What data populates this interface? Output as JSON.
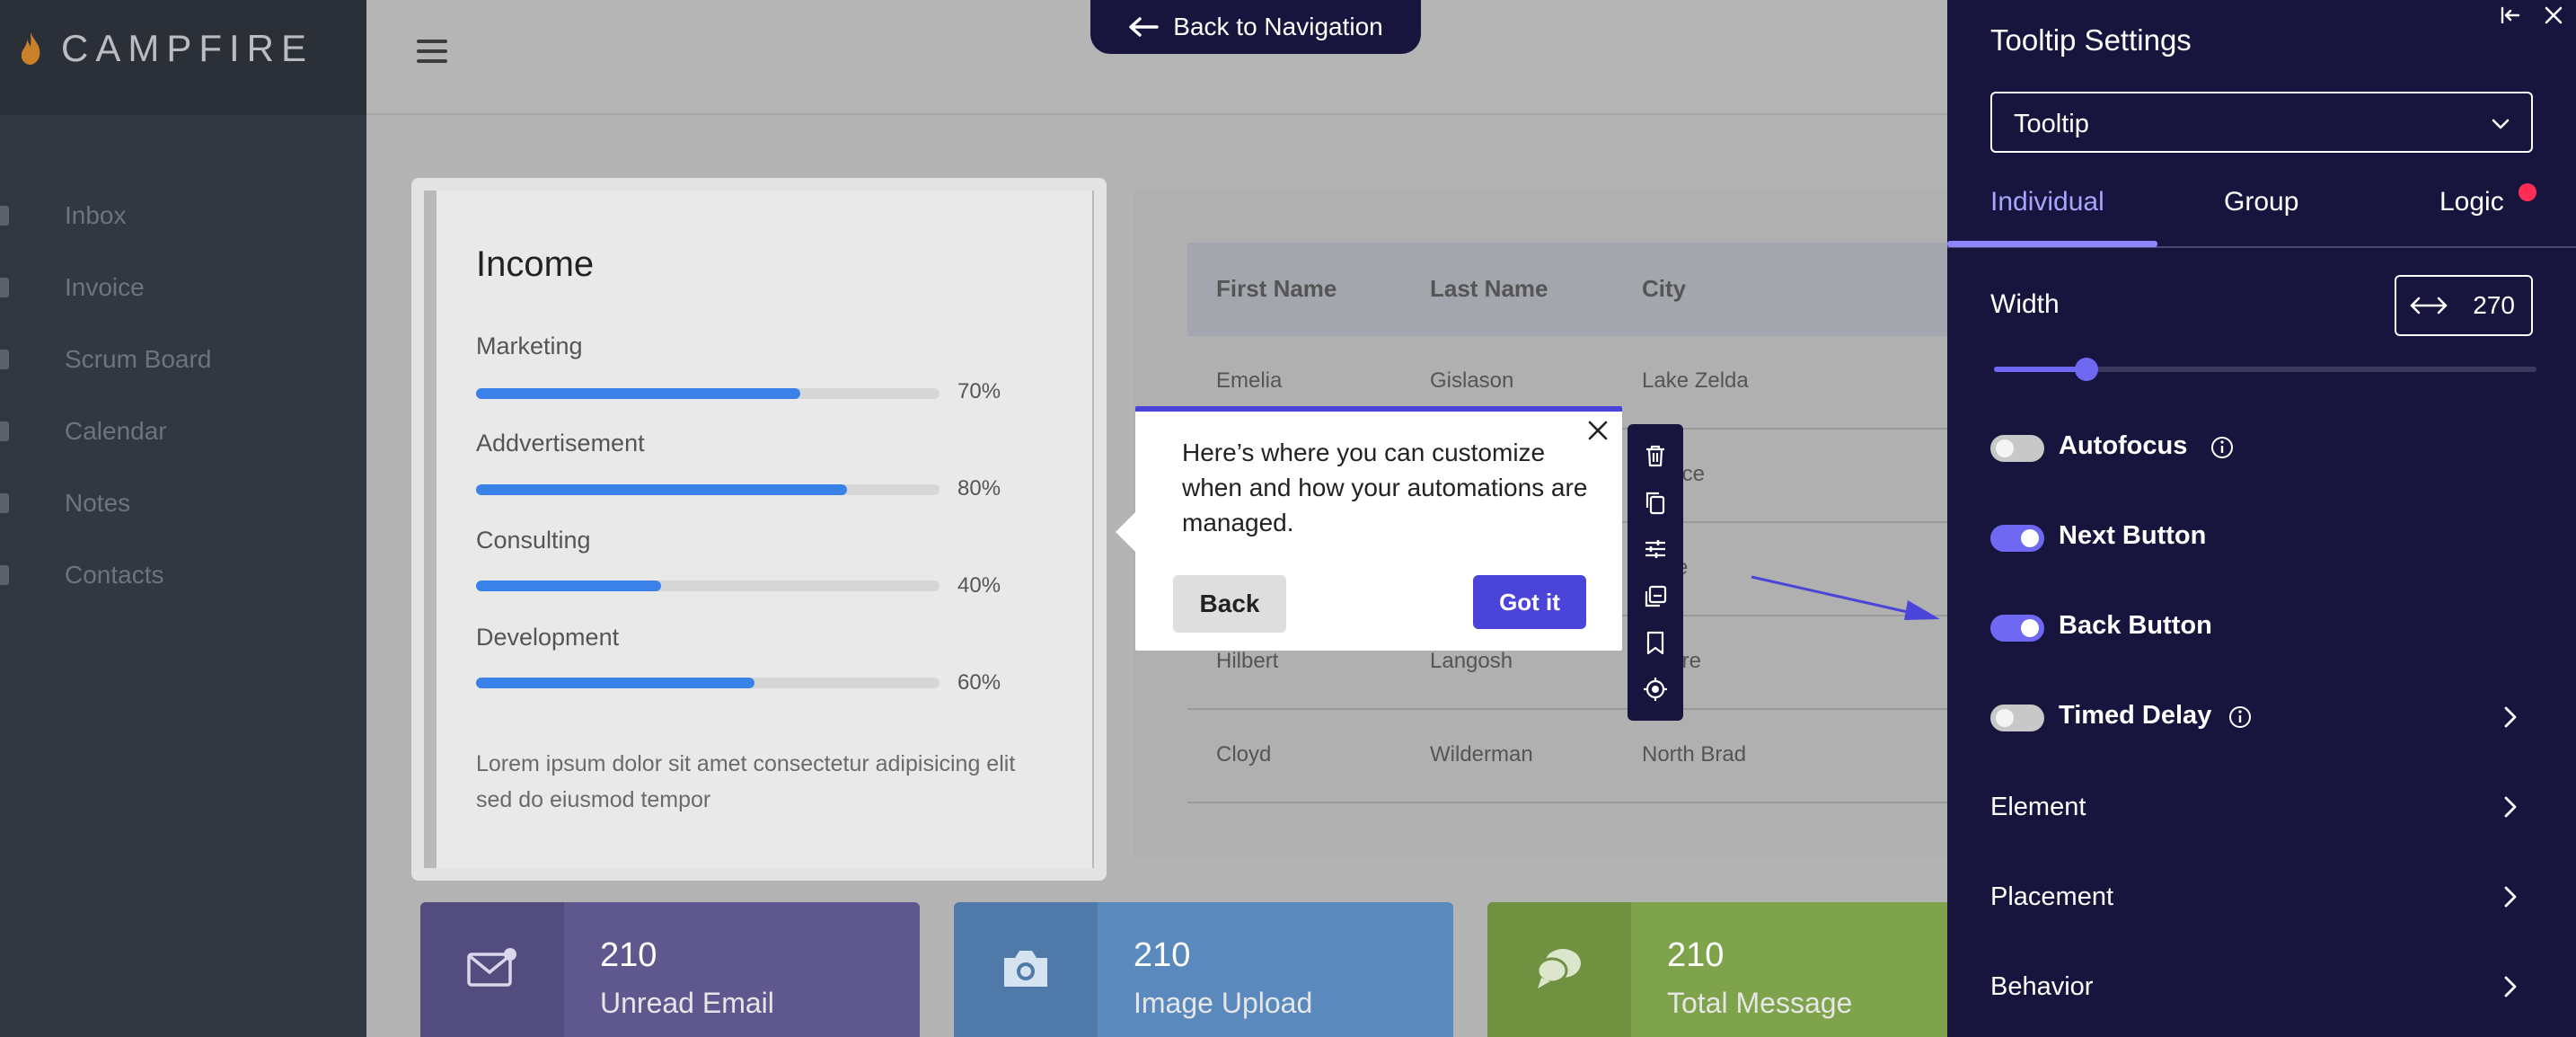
{
  "brand": {
    "name": "CAMPFIRE"
  },
  "sidebar": {
    "items": [
      {
        "label": "Inbox"
      },
      {
        "label": "Invoice"
      },
      {
        "label": "Scrum Board"
      },
      {
        "label": "Calendar"
      },
      {
        "label": "Notes"
      },
      {
        "label": "Contacts"
      }
    ]
  },
  "topbar": {
    "back_label": "Back to Navigation"
  },
  "income": {
    "title": "Income",
    "metrics": [
      {
        "label": "Marketing",
        "value": 70,
        "pct_text": "70%"
      },
      {
        "label": "Addvertisement",
        "value": 80,
        "pct_text": "80%"
      },
      {
        "label": "Consulting",
        "value": 40,
        "pct_text": "40%"
      },
      {
        "label": "Development",
        "value": 60,
        "pct_text": "60%"
      }
    ],
    "description": "Lorem ipsum dolor sit amet consectetur adipisicing elit sed do eiusmod tempor"
  },
  "table": {
    "headers": [
      "First Name",
      "Last Name",
      "City"
    ],
    "rows": [
      [
        "Emelia",
        "Gislason",
        "Lake Zelda"
      ],
      [
        "",
        "",
        "Pierce"
      ],
      [
        "",
        "",
        "lside"
      ],
      [
        "Hilbert",
        "Langosh",
        "sshire"
      ],
      [
        "Cloyd",
        "Wilderman",
        "North Brad"
      ]
    ]
  },
  "stats": [
    {
      "value": "210",
      "label": "Unread Email",
      "color": "#5f588f",
      "icon_bg": "#534d7f",
      "icon": "mail-icon"
    },
    {
      "value": "210",
      "label": "Image Upload",
      "color": "#5a89bd",
      "icon_bg": "#4f79a8",
      "icon": "camera-icon"
    },
    {
      "value": "210",
      "label": "Total Message",
      "color": "#7ea34b",
      "icon_bg": "#6f9140",
      "icon": "chat-icon"
    }
  ],
  "tooltip": {
    "text": "Here’s where you can customize when and how your automations are managed.",
    "back_label": "Back",
    "confirm_label": "Got it"
  },
  "panel": {
    "title": "Tooltip Settings",
    "type_select": {
      "value": "Tooltip"
    },
    "tabs": [
      {
        "label": "Individual",
        "active": true
      },
      {
        "label": "Group",
        "active": false
      },
      {
        "label": "Logic",
        "active": false,
        "badge": true
      }
    ],
    "width": {
      "label": "Width",
      "value": "270",
      "slider_fraction": 0.17
    },
    "toggles": [
      {
        "label": "Autofocus",
        "on": false,
        "info": true
      },
      {
        "label": "Next Button",
        "on": true,
        "info": false
      },
      {
        "label": "Back Button",
        "on": true,
        "info": false
      },
      {
        "label": "Timed Delay",
        "on": false,
        "info": true,
        "chevron": true
      }
    ],
    "sections": [
      {
        "label": "Element"
      },
      {
        "label": "Placement"
      },
      {
        "label": "Behavior"
      }
    ],
    "accent": "#6e68f2",
    "background": "#17153d"
  }
}
